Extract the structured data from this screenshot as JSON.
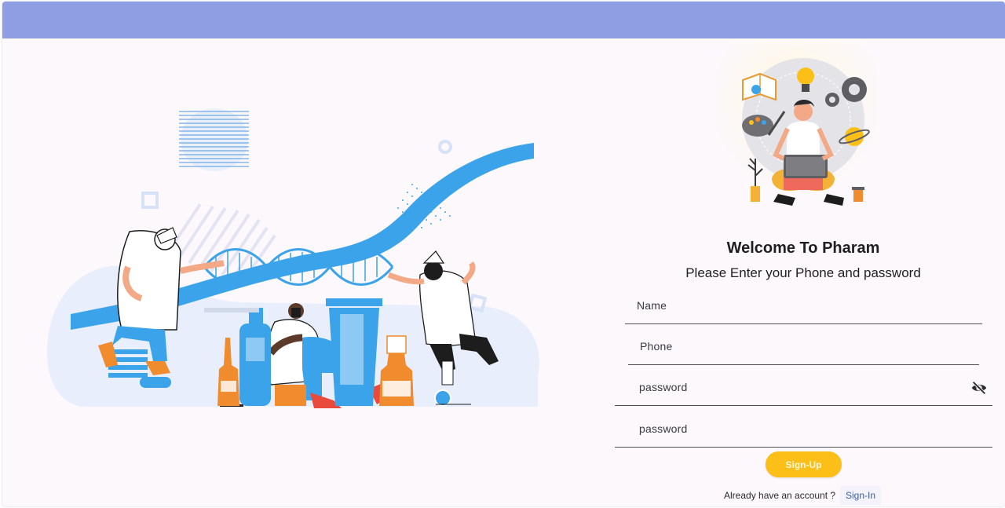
{
  "colors": {
    "appbar": "#8f9ee3",
    "page_background": "#fcf8fc",
    "accent_button": "#fbbf17",
    "link": "#3d5fa6",
    "illustration_blue": "#3aa3ea",
    "illustration_orange": "#f08b2e"
  },
  "header": {
    "title": "Welcome To Pharam",
    "subtitle": "Please Enter your Phone and password"
  },
  "form": {
    "name_label": "Name",
    "phone_label": "Phone",
    "password_label": "password",
    "confirm_password_label": "password",
    "password_toggle_icon": "eye-off-icon"
  },
  "actions": {
    "signup_label": "Sign-Up",
    "account_question": "Already have an account ?",
    "signin_label": "Sign-In"
  },
  "illustrations": {
    "hero": "scientists-dna-medicine-illustration",
    "profile": "person-with-laptop-illustration"
  }
}
